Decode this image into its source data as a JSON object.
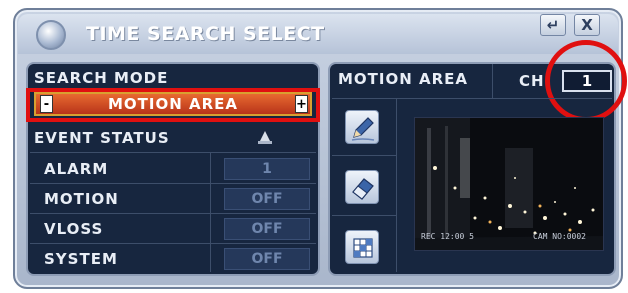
{
  "window": {
    "title": "TIME SEARCH SELECT",
    "enter_symbol": "↵",
    "close_symbol": "X"
  },
  "left_panel": {
    "search_mode_label": "SEARCH MODE",
    "search_mode_value": "MOTION AREA",
    "decrement_symbol": "-",
    "increment_symbol": "+",
    "event_status_label": "EVENT STATUS",
    "events": [
      {
        "label": "ALARM",
        "value": "1"
      },
      {
        "label": "MOTION",
        "value": "OFF"
      },
      {
        "label": "VLOSS",
        "value": "OFF"
      },
      {
        "label": "SYSTEM",
        "value": "OFF"
      }
    ]
  },
  "right_panel": {
    "header_label": "MOTION AREA",
    "channel_label": "CH",
    "channel_value": "1",
    "tools": [
      "pencil-icon",
      "eraser-icon",
      "grid-icon"
    ],
    "osd_left": "REC 12:00  5",
    "osd_right": "CAM NO:0002"
  },
  "colors": {
    "panel_bg": "#17263f",
    "selected_mode": "#c8401e",
    "highlight_annotation": "#e01010"
  }
}
